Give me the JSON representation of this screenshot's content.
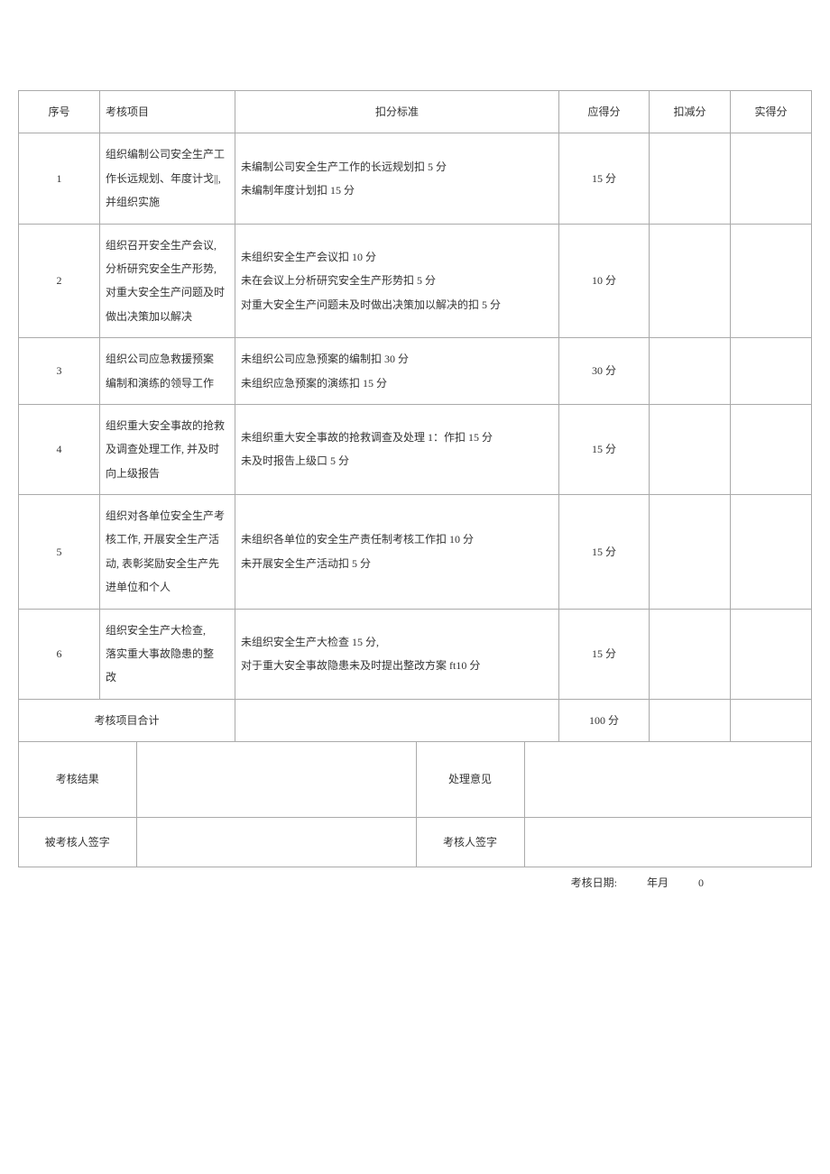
{
  "headers": {
    "seq": "序号",
    "item": "考核项目",
    "standard": "扣分标准",
    "score": "应得分",
    "deduct": "扣减分",
    "actual": "实得分"
  },
  "rows": [
    {
      "seq": "1",
      "item": "组织编制公司安全生产工作长远规划、年度计戈||, 并组织实施",
      "standard": "未编制公司安全生产工作的长远规划扣 5 分\n未编制年度计划扣 15 分",
      "score": "15 分",
      "deduct": "",
      "actual": ""
    },
    {
      "seq": "2",
      "item": "组织召开安全生产会议, 分析研究安全生产形势, 对重大安全生产问题及时做出决策加以解决",
      "standard": "未组织安全生产会议扣 10 分\n未在会议上分析研究安全生产形势扣 5 分\n对重大安全生产问题未及时做出决策加以解决的扣 5 分",
      "score": "10 分",
      "deduct": "",
      "actual": ""
    },
    {
      "seq": "3",
      "item": "组织公司应急救援预案\n编制和演练的领导工作",
      "standard": "未组织公司应急预案的编制扣 30 分\n未组织应急预案的演练扣 15 分",
      "score": "30 分",
      "deduct": "",
      "actual": ""
    },
    {
      "seq": "4",
      "item": "组织重大安全事故的抢救及调查处理工作, 并及时向上级报告",
      "standard": "未组织重大安全事故的抢救调查及处理 1：作扣 15 分\n未及时报告上级口 5 分",
      "score": "15 分",
      "deduct": "",
      "actual": ""
    },
    {
      "seq": "5",
      "item": "组织对各单位安全生产考核工作, 开展安全生产活动, 表彰奖励安全生产先进单位和个人",
      "standard": "未组织各单位的安全生产责任制考核工作扣 10 分\n未开展安全生产活动扣 5 分",
      "score": "15 分",
      "deduct": "",
      "actual": ""
    },
    {
      "seq": "6",
      "item": "组织安全生产大检查,\n落实重大事故隐患的整\n改",
      "standard": "未组织安全生产大检查 15 分,\n对于重大安全事故隐患未及时提出整改方案 ft10 分",
      "score": "15 分",
      "deduct": "",
      "actual": ""
    }
  ],
  "total": {
    "label": "考核项目合计",
    "score": "100 分",
    "deduct": "",
    "actual": ""
  },
  "result_row": {
    "label_result": "考核结果",
    "value_result": "",
    "label_opinion": "处理意见",
    "value_opinion": ""
  },
  "sign_row": {
    "label_assessed": "被考核人签字",
    "value_assessed": "",
    "label_assessor": "考核人签字",
    "value_assessor": ""
  },
  "footer": {
    "date_label": "考核日期:",
    "year_month": "年月",
    "zero": "0"
  }
}
